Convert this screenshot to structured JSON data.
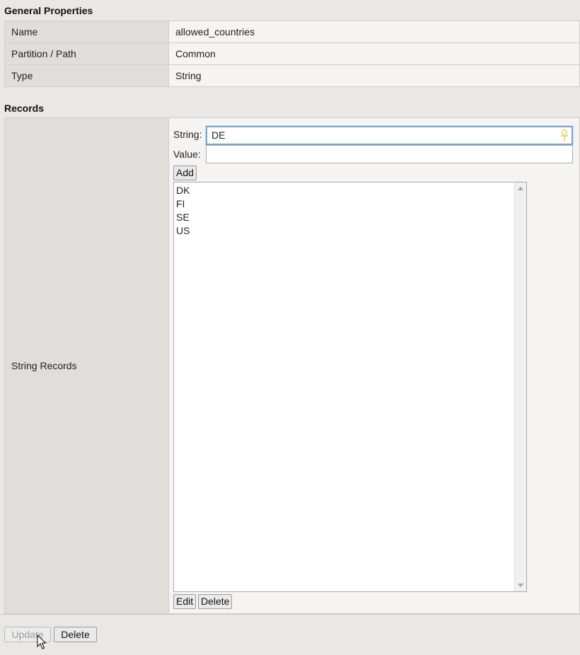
{
  "general": {
    "title": "General Properties",
    "rows": [
      {
        "label": "Name",
        "value": "allowed_countries"
      },
      {
        "label": "Partition / Path",
        "value": "Common"
      },
      {
        "label": "Type",
        "value": "String"
      }
    ]
  },
  "records": {
    "title": "Records",
    "row_label": "String Records",
    "string_label": "String:",
    "string_value": "DE",
    "value_label": "Value:",
    "value_value": "",
    "add_label": "Add",
    "items": [
      "DK",
      "FI",
      "SE",
      "US"
    ],
    "edit_label": "Edit",
    "delete_label": "Delete"
  },
  "footer": {
    "update_label": "Update",
    "delete_label": "Delete"
  },
  "icons": {
    "input_icon": "ankh-icon",
    "cursor": "mouse-pointer-icon"
  },
  "colors": {
    "focus_border": "#7da2ce",
    "label_bg": "#dfdedb",
    "page_bg": "#eae8e4"
  }
}
